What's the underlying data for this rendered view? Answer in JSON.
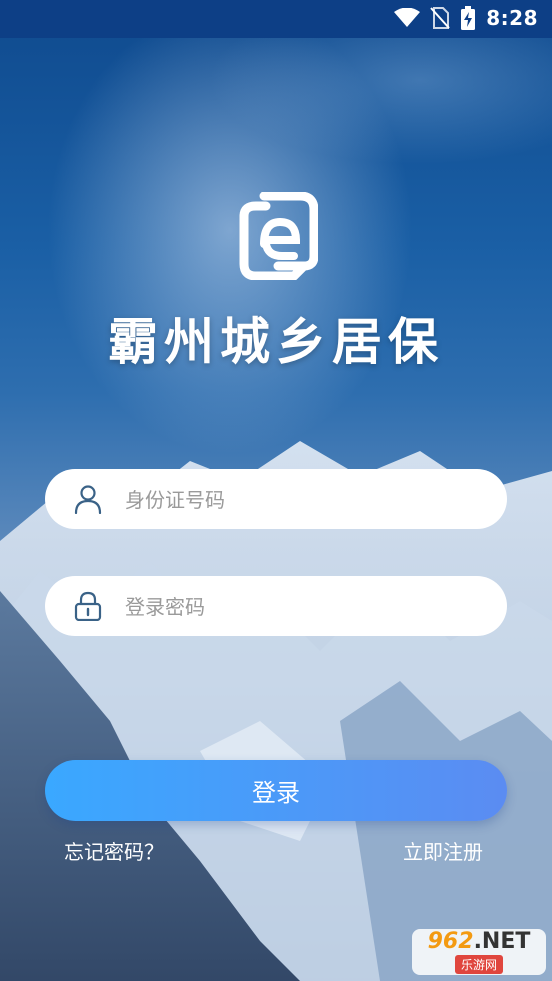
{
  "status_bar": {
    "time": "8:28",
    "icons": [
      "wifi-icon",
      "no-sim-icon",
      "battery-charging-icon"
    ]
  },
  "app": {
    "logo_icon": "app-logo-icon",
    "title": "霸州城乡居保"
  },
  "form": {
    "id_number": {
      "placeholder": "身份证号码",
      "icon": "user-icon",
      "value": ""
    },
    "password": {
      "placeholder": "登录密码",
      "icon": "lock-icon",
      "value": ""
    },
    "login_label": "登录",
    "forgot_label": "忘记密码？",
    "register_label": "立即注册"
  },
  "watermark": {
    "top_prefix": "962",
    "top_suffix": ".NET",
    "bottom": "乐游网"
  },
  "colors": {
    "status_bar": "#0d3f86",
    "button_start": "#3aa8ff",
    "button_end": "#5b8cf2"
  }
}
